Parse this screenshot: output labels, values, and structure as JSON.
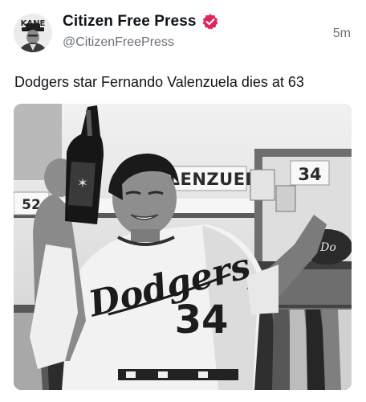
{
  "post": {
    "author": {
      "display_name": "Citizen Free Press",
      "handle": "@CitizenFreePress",
      "avatar_text": "KANE",
      "verified": true,
      "verified_badge_color": "#e0245e"
    },
    "time": "5m",
    "text": "Dodgers star Fernando Valenzuela dies at 63",
    "image": {
      "nameplate_text": "VALENZUEL",
      "locker_number": "34",
      "side_locker_number": "52",
      "jersey_script": "Dodgers",
      "jersey_number": "34"
    }
  },
  "colors": {
    "text_primary": "#0f1419",
    "text_secondary": "#6b7178",
    "background": "#ffffff"
  }
}
